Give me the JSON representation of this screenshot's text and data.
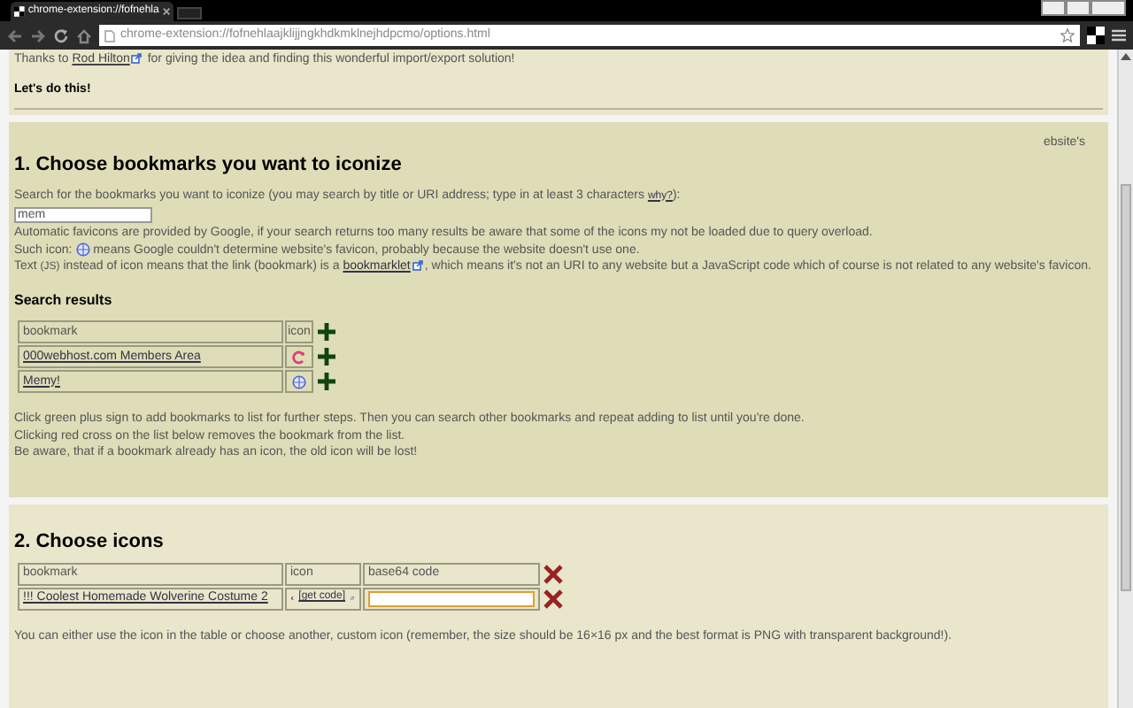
{
  "browser": {
    "tab_title": "chrome-extension://fofnehla",
    "url": "chrome-extension://fofnehlaajklijjngkhdkmklnejhdpcmo/options.html"
  },
  "intro": {
    "thanks_before": "Thanks to",
    "thanks_link": "Rod Hilton",
    "thanks_after": "for giving the idea and finding this wonderful import/export solution!",
    "cta": "Let's do this!"
  },
  "section1": {
    "stray_text": "ebsite's",
    "heading": "1. Choose bookmarks you want to iconize",
    "search_label": "Search for the bookmarks you want to iconize (you may search by title or URI address; type in at least 3 characters",
    "search_link": "why?",
    "search_label_end": "):",
    "search_value": "mem",
    "note_1": "Automatic favicons are provided by Google, if your search returns too many results be aware that some of the icons my not be loaded due to query overload.",
    "note_2_before": "Such icon:",
    "note_2_after": "means Google couldn't determine website's favicon, probably because the website doesn't use one.",
    "note_3_before": "Text",
    "note_3_js": "(JS)",
    "note_3_middle": "instead of icon means that the link (bookmark) is a",
    "note_3_link": "bookmarklet",
    "note_3_after": ", which means it's not an URI to any website but a JavaScript code which of course is not related to any website's favicon.",
    "results_heading": "Search results",
    "columns": [
      "bookmark",
      "icon"
    ],
    "rows": [
      {
        "title": "000webhost.com Members Area",
        "kind": "swirl"
      },
      {
        "title": "Memy!",
        "kind": "globe"
      }
    ],
    "footer": [
      "Click green plus sign to add bookmarks to list for further steps. Then you can search other bookmarks and repeat adding to list until you're done.",
      "Clicking red cross on the list below removes the bookmark from the list.",
      "Be aware, that if a bookmark already has an icon, the old icon will be lost!"
    ]
  },
  "section2": {
    "heading": "2. Choose icons",
    "columns": [
      "bookmark",
      "icon",
      "base64 code"
    ],
    "rows": [
      {
        "title": "!!! Coolest Homemade Wolverine Costume 2",
        "kind": "crescent",
        "code_link": "[get code]"
      }
    ],
    "note": "You can either use the icon in the table or choose another, custom icon (remember, the size should be 16×16 px and the best format is PNG with transparent background!)."
  }
}
